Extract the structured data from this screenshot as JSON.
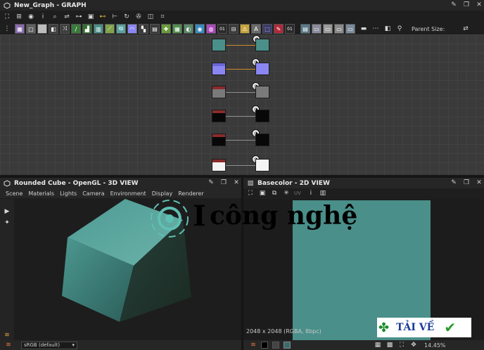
{
  "graph_window": {
    "title": "New_Graph - GRAPH",
    "parent_size_label": "Parent Size:",
    "node_labels": [
      "01",
      "01"
    ]
  },
  "view3d": {
    "title": "Rounded Cube - OpenGL - 3D VIEW",
    "menu": [
      "Scene",
      "Materials",
      "Lights",
      "Camera",
      "Environment",
      "Display",
      "Renderer"
    ],
    "colorspace": "sRGB (default)"
  },
  "view2d": {
    "title": "Basecolor - 2D VIEW",
    "channel_label": "UV",
    "info": "2048 x 2048 (RGBA, 8bpc)",
    "zoom": "14.45%"
  },
  "watermark": {
    "text": "công nghệ",
    "prefix": "I",
    "badge": "TẢI VỀ"
  },
  "colors": {
    "teal": "#4a8f89",
    "purple": "#8a86f2",
    "gray": "#7a7a7a",
    "accent_orange": "#d08a2a"
  }
}
